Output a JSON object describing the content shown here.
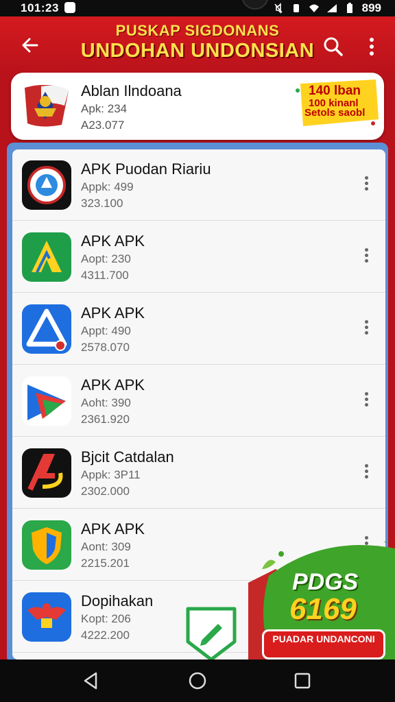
{
  "status": {
    "time": "101:23",
    "battery": "899"
  },
  "appbar": {
    "title_line1": "PUSKAP SIGDONANS",
    "title_line2": "UNDOHAN UNDONSIAN"
  },
  "featured": {
    "name": "Ablan Ilndoana",
    "sub": "Apk: 234",
    "size": "A23.077",
    "badge_line1": "140 lban",
    "badge_line2": "100 kinanl",
    "badge_line3": "Setols saobl"
  },
  "apps": [
    {
      "name": "APK Puodan Riariu",
      "sub": "Appk: 499",
      "size": "323.100",
      "icon": "blue-circle-emblem-icon"
    },
    {
      "name": "APK APK",
      "sub": "Aopt: 230",
      "size": "4311.700",
      "icon": "yellow-arrow-icon"
    },
    {
      "name": "APK APK",
      "sub": "Appt: 490",
      "size": "2578.070",
      "icon": "blue-triangle-icon"
    },
    {
      "name": "APK APK",
      "sub": "Aoht: 390",
      "size": "2361.920",
      "icon": "colorful-triangle-icon"
    },
    {
      "name": "Bjcit Catdalan",
      "sub": "Appk: 3P11",
      "size": "2302.000",
      "icon": "red-a-logo-icon"
    },
    {
      "name": "APK APK",
      "sub": "Aont: 309",
      "size": "2215.201",
      "icon": "shield-icon"
    },
    {
      "name": "Dopihakan",
      "sub": "Kopt: 206",
      "size": "4222.200",
      "icon": "garuda-icon"
    }
  ],
  "promo": {
    "title": "PDGS",
    "number": "6169",
    "button": "PUADAR UNDANCONI"
  },
  "colors": {
    "brand_red": "#d41a1f",
    "title_yellow": "#ffe14d",
    "promo_green": "#3fa42a"
  }
}
